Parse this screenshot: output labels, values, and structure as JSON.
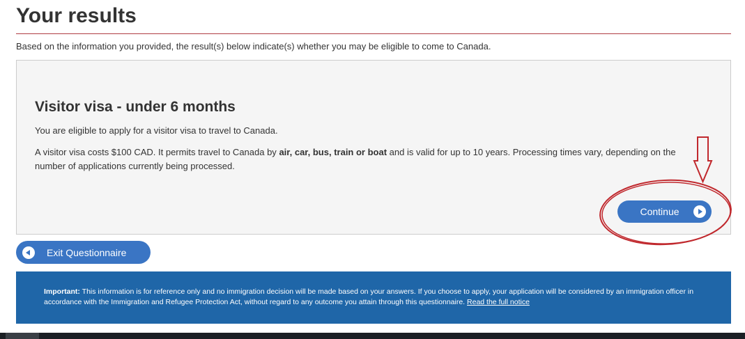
{
  "page": {
    "title": "Your results",
    "intro": "Based on the information you provided, the result(s) below indicate(s) whether you may be eligible to come to Canada."
  },
  "result": {
    "heading": "Visitor visa - under 6 months",
    "eligibility": "You are eligible to apply for a visitor visa to travel to Canada.",
    "cost_part1": "A visitor visa costs $100 CAD. It permits travel to Canada by ",
    "cost_bold": "air, car, bus, train or boat",
    "cost_part2": " and is valid for up to 10 years. Processing times vary, depending on the number of applications currently being processed.",
    "continue_label": "Continue",
    "continue_icon": "play-circle-icon"
  },
  "exit": {
    "label": "Exit Questionnaire",
    "icon": "back-circle-icon"
  },
  "notice": {
    "important_label": "Important:",
    "text": " This information is for reference only and no immigration decision will be made based on your answers. If you choose to apply, your application will be considered by an immigration officer in accordance with the Immigration and Refugee Protection Act, without regard to any outcome you attain through this questionnaire. ",
    "link_label": "Read the full notice"
  },
  "colors": {
    "accent_button": "#3a75c4",
    "banner": "#1f66a8",
    "title_rule": "#af3c43",
    "annotation": "#c0282d"
  },
  "annotation": {
    "arrow_icon": "down-arrow-icon",
    "ellipse_icon": "highlight-ellipse-icon"
  }
}
